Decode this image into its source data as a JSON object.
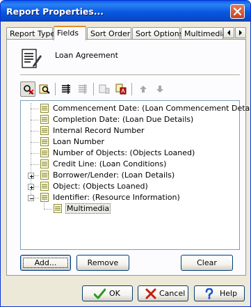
{
  "window": {
    "title": "Report Properties..."
  },
  "tabs": [
    {
      "label": "Report Type",
      "active": false
    },
    {
      "label": "Fields",
      "active": true
    },
    {
      "label": "Sort Order",
      "active": false
    },
    {
      "label": "Sort Options",
      "active": false
    },
    {
      "label": "Multimedia",
      "active": false
    }
  ],
  "report": {
    "name": "Loan Agreement"
  },
  "toolbar": [
    {
      "icon": "find-field-icon",
      "enabled": true,
      "pressed": true
    },
    {
      "icon": "find-next-icon",
      "enabled": true,
      "pressed": false
    },
    {
      "icon": "properties-icon",
      "enabled": true,
      "pressed": false
    },
    {
      "icon": "properties-alt-icon",
      "enabled": false,
      "pressed": false
    },
    {
      "icon": "field-type-icon",
      "enabled": false,
      "pressed": false
    },
    {
      "icon": "field-label-icon",
      "enabled": true,
      "pressed": false
    },
    {
      "icon": "move-up-icon",
      "enabled": false,
      "pressed": false
    },
    {
      "icon": "move-down-icon",
      "enabled": false,
      "pressed": false
    }
  ],
  "tree": [
    {
      "label": "Commencement Date: (Loan Commencement Details)",
      "level": 0,
      "expander": "none"
    },
    {
      "label": "Completion Date: (Loan Due Details)",
      "level": 0,
      "expander": "none"
    },
    {
      "label": "Internal Record Number",
      "level": 0,
      "expander": "none"
    },
    {
      "label": "Loan Number",
      "level": 0,
      "expander": "none"
    },
    {
      "label": "Number of Objects: (Objects Loaned)",
      "level": 0,
      "expander": "none"
    },
    {
      "label": "Credit Line: (Loan Conditions)",
      "level": 0,
      "expander": "none"
    },
    {
      "label": "Borrower/Lender: (Loan Details)",
      "level": 0,
      "expander": "plus"
    },
    {
      "label": "Object: (Objects Loaned)",
      "level": 0,
      "expander": "plus"
    },
    {
      "label": "Identifier: (Resource Information)",
      "level": 0,
      "expander": "minus"
    },
    {
      "label": "Multimedia",
      "level": 1,
      "expander": "none",
      "selected": true
    }
  ],
  "buttons": {
    "add": "Add...",
    "remove": "Remove",
    "clear": "Clear",
    "ok": "OK",
    "cancel": "Cancel",
    "help": "Help"
  },
  "colors": {
    "title_bar": "#0858e0",
    "tab_highlight": "#e68b2c",
    "field_icon": "#8a8a2e",
    "ok_check": "#2a9a1e",
    "cancel_x": "#c41e12",
    "help_q": "#1b52c6"
  }
}
